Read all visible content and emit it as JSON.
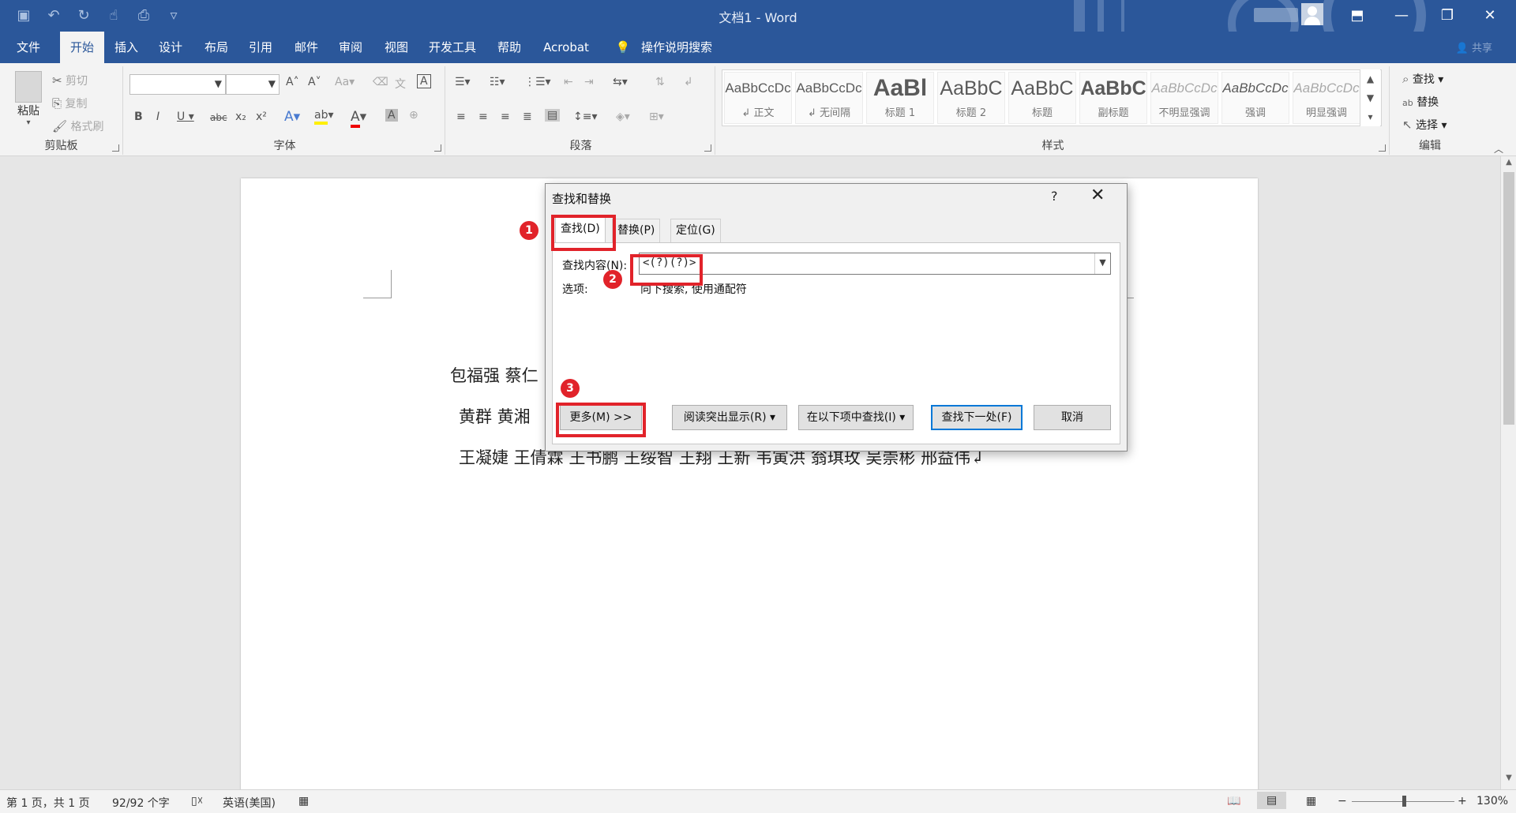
{
  "window": {
    "title": "文档1  -  Word",
    "share_label": "共享",
    "controls": [
      "ribbon-display-icon",
      "minimize-icon",
      "restore-icon",
      "close-icon"
    ]
  },
  "ribbon_tabs": [
    "文件",
    "开始",
    "插入",
    "设计",
    "布局",
    "引用",
    "邮件",
    "审阅",
    "视图",
    "开发工具",
    "帮助",
    "Acrobat",
    "操作说明搜索"
  ],
  "clipboard": {
    "label": "剪贴板",
    "paste": "粘贴",
    "cut": "剪切",
    "copy": "复制",
    "format_painter": "格式刷"
  },
  "font": {
    "label": "字体",
    "font_name": "",
    "font_size": ""
  },
  "paragraph": {
    "label": "段落"
  },
  "styles": {
    "label": "样式",
    "items": [
      {
        "sample": "AaBbCcDc",
        "name": "↲ 正文"
      },
      {
        "sample": "AaBbCcDc",
        "name": "↲ 无间隔"
      },
      {
        "sample": "AaBl",
        "name": "标题 1"
      },
      {
        "sample": "AaBbC",
        "name": "标题 2"
      },
      {
        "sample": "AaBbC",
        "name": "标题"
      },
      {
        "sample": "AaBbC",
        "name": "副标题"
      },
      {
        "sample": "AaBbCcDc",
        "name": "不明显强调"
      },
      {
        "sample": "AaBbCcDc",
        "name": "强调"
      },
      {
        "sample": "AaBbCcDc",
        "name": "明显强调"
      }
    ]
  },
  "editing": {
    "label": "编辑",
    "find": "查找",
    "replace": "替换",
    "select": "选择"
  },
  "document": {
    "lines": [
      "包福强  蔡仁",
      "黄群  黄湘",
      "王凝婕  王倩霖  王书鹏  王绥智  王翔  王新  韦寅洪  翁琪玫  吴崇彬  邢益伟↲"
    ]
  },
  "dialog": {
    "title": "查找和替换",
    "help": "?",
    "tabs": [
      "查找(D)",
      "替换(P)",
      "定位(G)"
    ],
    "find_label": "查找内容(N):",
    "find_value": "<(?)(?)>",
    "options_label": "选项:",
    "options_value": "向下搜索, 使用通配符",
    "buttons": {
      "more": "更多(M) >>",
      "reading_highlight": "阅读突出显示(R) ▾",
      "find_in": "在以下项中查找(I) ▾",
      "find_next": "查找下一处(F)",
      "cancel": "取消"
    }
  },
  "annotations": [
    "1",
    "2",
    "3"
  ],
  "statusbar": {
    "page": "第 1 页，共 1 页",
    "words": "92/92 个字",
    "language": "英语(美国)",
    "zoom": "130%",
    "zoom_minus": "−",
    "zoom_plus": "+"
  },
  "colors": {
    "word_blue": "#2b579a",
    "annotation_red": "#e1232a"
  }
}
